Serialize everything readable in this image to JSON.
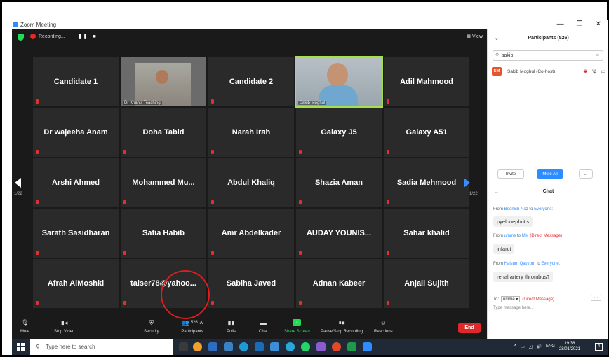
{
  "window": {
    "title": "Zoom Meeting",
    "controls": [
      "—",
      "❐",
      "✕"
    ]
  },
  "recording": {
    "label": "Recording...",
    "pause": "❚❚",
    "stop": "■"
  },
  "view_label": "▦ View",
  "tiles": [
    {
      "name": "Candidate 1"
    },
    {
      "name": "",
      "caption": "Dr Khan's Teaching",
      "video": "person1"
    },
    {
      "name": "Candidate 2"
    },
    {
      "name": "",
      "caption": "Sakib Moghul",
      "video": "person2",
      "active": true
    },
    {
      "name": "Adil Mahmood"
    },
    {
      "name": "Dr wajeeha Anam"
    },
    {
      "name": "Doha Tabid"
    },
    {
      "name": "Narah Irah"
    },
    {
      "name": "Galaxy J5"
    },
    {
      "name": "Galaxy A51"
    },
    {
      "name": "Arshi Ahmed"
    },
    {
      "name": "Mohammed Mu..."
    },
    {
      "name": "Abdul Khaliq"
    },
    {
      "name": "Shazia Aman"
    },
    {
      "name": "Sadia Mehmood"
    },
    {
      "name": "Sarath Sasidharan"
    },
    {
      "name": "Safia Habib"
    },
    {
      "name": "Amr Abdelkader"
    },
    {
      "name": "AUDAY YOUNIS..."
    },
    {
      "name": "Sahar khalid"
    },
    {
      "name": "Afrah AlMoshki"
    },
    {
      "name": "taiser78@yahoo..."
    },
    {
      "name": "Sabiha Javed"
    },
    {
      "name": "Adnan Kabeer"
    },
    {
      "name": "Anjali Sujith"
    }
  ],
  "paging": {
    "left": "1/22",
    "right": "1/22"
  },
  "toolbar": {
    "mute": "Mute",
    "stop_video": "Stop Video",
    "security": "Security",
    "participants": "Participants",
    "participants_count": "526",
    "polls": "Polls",
    "chat": "Chat",
    "share_screen": "Share Screen",
    "pause_recording": "Pause/Stop Recording",
    "reactions": "Reactions",
    "end": "End"
  },
  "participants_panel": {
    "header": "Participants (526)",
    "search_value": "sakib",
    "row": {
      "initials": "SM",
      "name": "Sakib Moghul (Co-host)"
    },
    "invite": "Invite",
    "mute_all": "Mute All",
    "more": "..."
  },
  "chat": {
    "header": "Chat",
    "messages": [
      {
        "from": "From",
        "sender": "Beenish Naz",
        "to": "to",
        "recipient": "Everyone:",
        "text": "pyelonephritis",
        "dm": ""
      },
      {
        "from": "From",
        "sender": "umme",
        "to": "to",
        "recipient": "Me:",
        "text": "infarct",
        "dm": "(Direct Message)"
      },
      {
        "from": "From",
        "sender": "Haisum Qayyum",
        "to": "to",
        "recipient": "Everyone:",
        "text": "renal artery thrombus?",
        "dm": ""
      }
    ],
    "to_label": "To:",
    "to_value": "umme ▾",
    "to_dm": "(Direct Message)",
    "placeholder": "Type message here...",
    "more": "···"
  },
  "taskbar": {
    "search_placeholder": "Type here to search",
    "lang": "ENG",
    "time": "19:38",
    "date": "28/01/2021",
    "notif_count": "4"
  }
}
